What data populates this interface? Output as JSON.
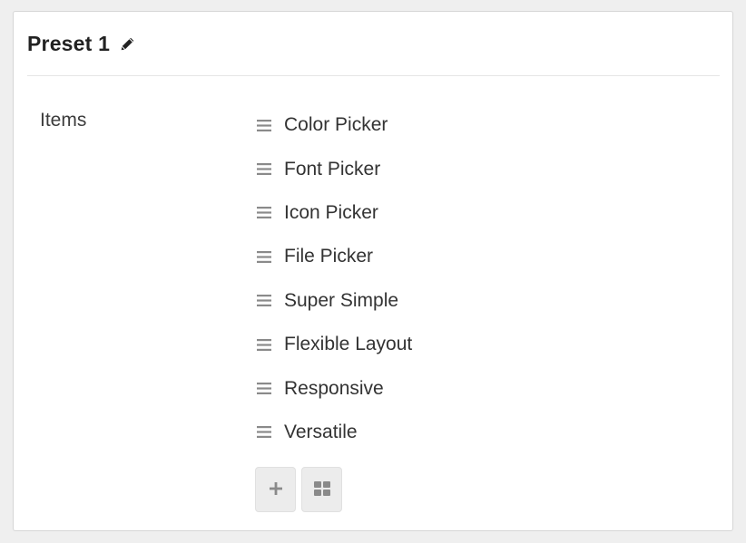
{
  "panel": {
    "title": "Preset 1",
    "edit_icon": "pencil-icon"
  },
  "field": {
    "label": "Items",
    "items": [
      {
        "label": "Color Picker",
        "handle_icon": "drag-handle-icon"
      },
      {
        "label": "Font Picker",
        "handle_icon": "drag-handle-icon"
      },
      {
        "label": "Icon Picker",
        "handle_icon": "drag-handle-icon"
      },
      {
        "label": "File Picker",
        "handle_icon": "drag-handle-icon"
      },
      {
        "label": "Super Simple",
        "handle_icon": "drag-handle-icon"
      },
      {
        "label": "Flexible Layout",
        "handle_icon": "drag-handle-icon"
      },
      {
        "label": "Responsive",
        "handle_icon": "drag-handle-icon"
      },
      {
        "label": "Versatile",
        "handle_icon": "drag-handle-icon"
      }
    ]
  },
  "actions": {
    "add_icon": "plus-icon",
    "grid_icon": "grid-icon"
  },
  "colors": {
    "background": "#efefef",
    "panel": "#ffffff",
    "icon": "#8a8a8a",
    "button": "#ececec"
  }
}
